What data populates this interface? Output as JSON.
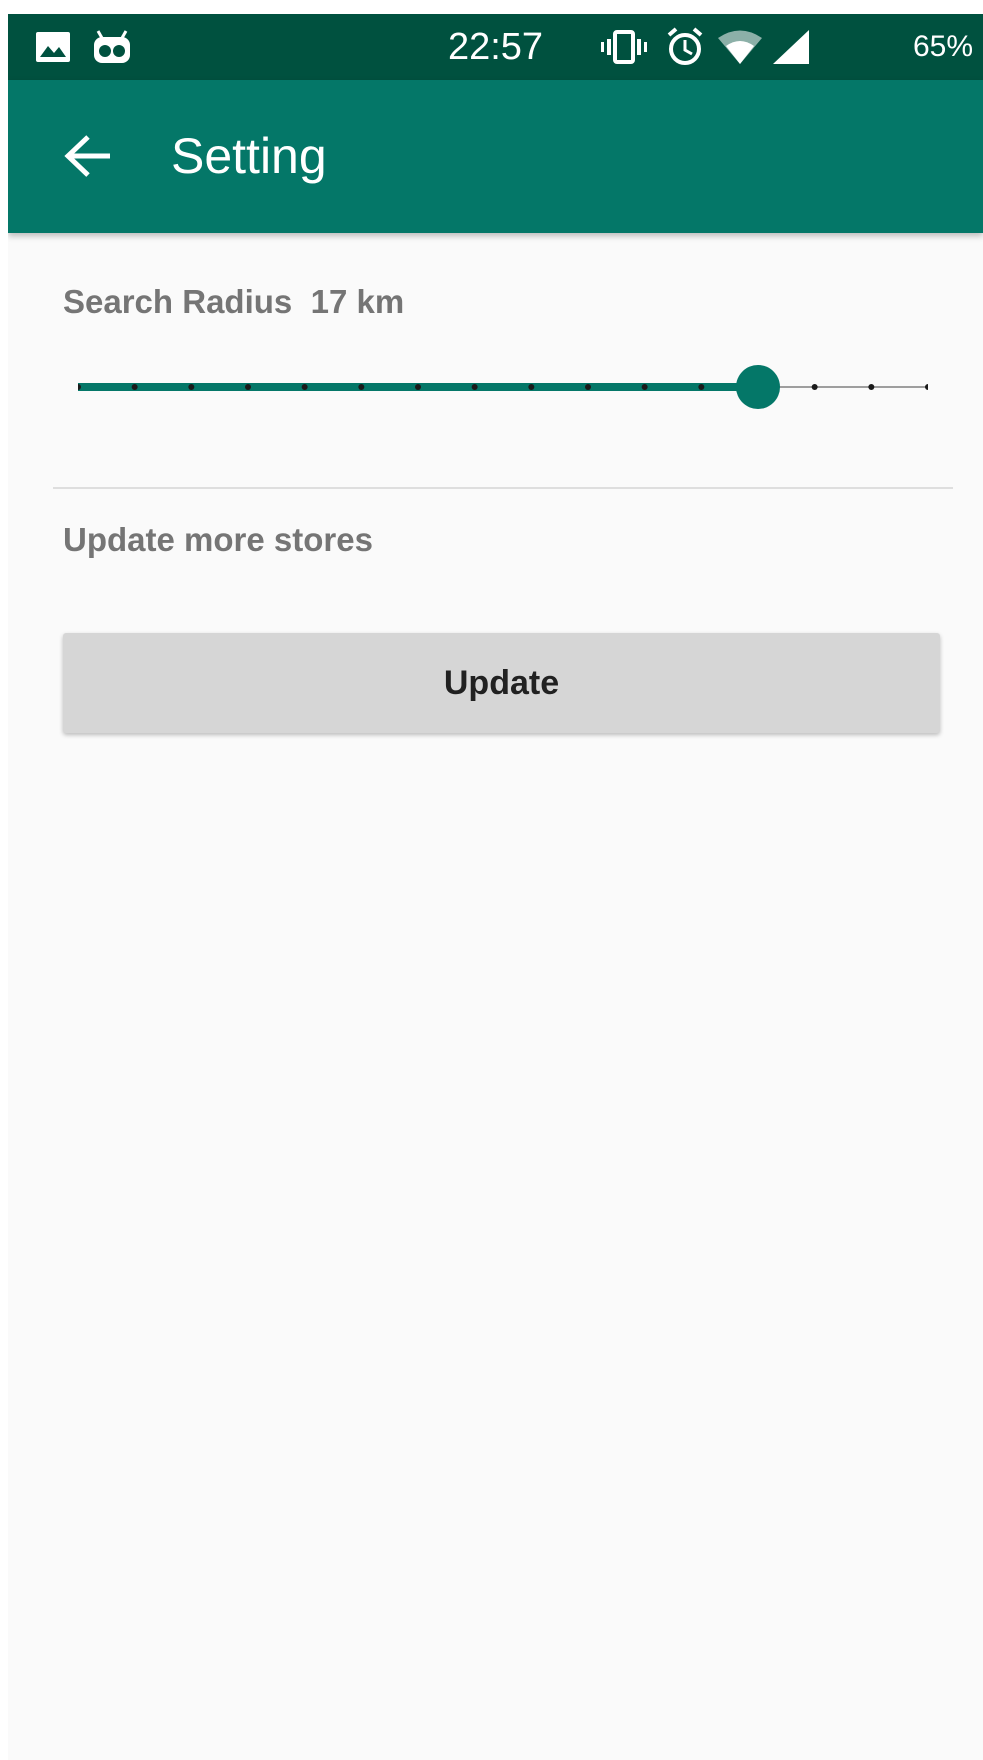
{
  "status_bar": {
    "time": "22:57",
    "battery": "65%",
    "icons": [
      "image-icon",
      "ghost-notification-icon",
      "vibrate-icon",
      "alarm-icon",
      "wifi-icon",
      "cell-signal-icon"
    ]
  },
  "app_bar": {
    "title": "Setting",
    "back_icon": "arrow-back-icon"
  },
  "settings": {
    "search_radius_label": "Search Radius  17 km",
    "search_radius_slider": {
      "steps": 16,
      "selected_step": 12,
      "active_color": "#047768"
    },
    "update_more_label": "Update more stores",
    "update_button_label": "Update"
  },
  "colors": {
    "status_bar": "#00513f",
    "app_bar": "#047768",
    "accent": "#047768",
    "background": "#fafafa",
    "button": "#d6d6d6"
  }
}
